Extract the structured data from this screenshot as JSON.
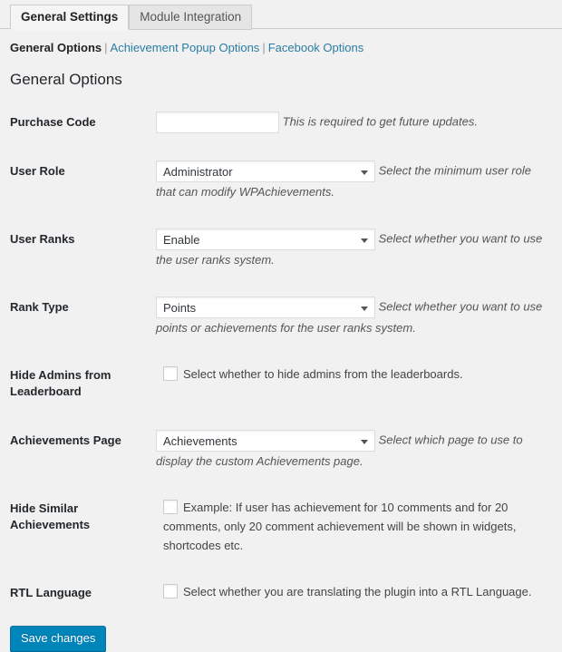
{
  "tabs": [
    {
      "label": "General Settings",
      "active": true
    },
    {
      "label": "Module Integration",
      "active": false
    }
  ],
  "subnav": {
    "current": "General Options",
    "separator": "|",
    "links": [
      "Achievement Popup Options",
      "Facebook Options"
    ]
  },
  "page_title": "General Options",
  "fields": {
    "purchase_code": {
      "label": "Purchase Code",
      "value": "",
      "description": "This is required to get future updates."
    },
    "user_role": {
      "label": "User Role",
      "value": "Administrator",
      "description": "Select the minimum user role that can modify WPAchievements."
    },
    "user_ranks": {
      "label": "User Ranks",
      "value": "Enable",
      "description": "Select whether you want to use the user ranks system."
    },
    "rank_type": {
      "label": "Rank Type",
      "value": "Points",
      "description": "Select whether you want to use points or achievements for the user ranks system."
    },
    "hide_admins": {
      "label": "Hide Admins from Leaderboard",
      "checked": false,
      "description": "Select whether to hide admins from the leaderboards."
    },
    "achievements_page": {
      "label": "Achievements Page",
      "value": "Achievements",
      "description": "Select which page to use to display the custom Achievements page."
    },
    "hide_similar": {
      "label": "Hide Similar Achievements",
      "checked": false,
      "description": "Example: If user has achievement for 10 comments and for 20 comments, only 20 comment achievement will be shown in widgets, shortcodes etc."
    },
    "rtl_language": {
      "label": "RTL Language",
      "checked": false,
      "description": "Select whether you are translating the plugin into a RTL Language."
    }
  },
  "save_button": {
    "label": "Save changes"
  },
  "colors": {
    "accent": "#0085ba",
    "link": "#2b7ca5",
    "page_background": "#f1f1f1"
  }
}
